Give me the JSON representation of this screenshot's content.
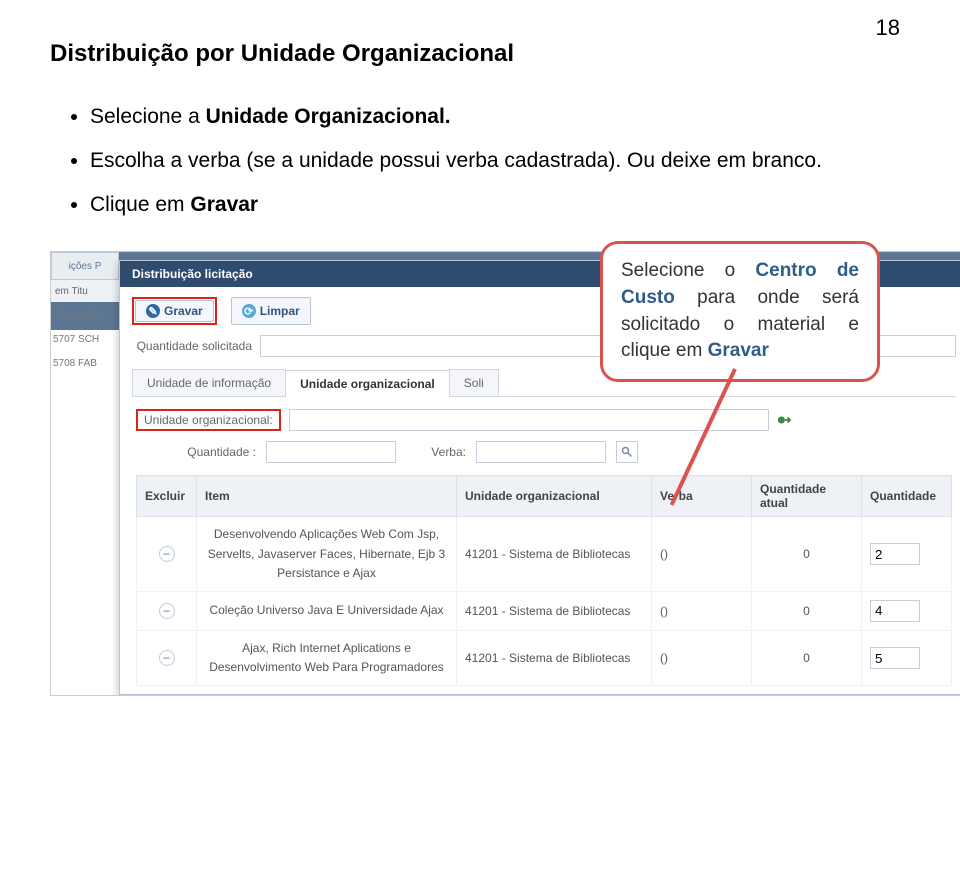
{
  "page_number": "18",
  "title": "Distribuição por Unidade Organizacional",
  "instructions": {
    "i1a": "Selecione a ",
    "i1b": "Unidade Organizacional.",
    "i2": "Escolha a verba (se a unidade possui verba cadastrada). Ou deixe em branco.",
    "i3a": "Clique em ",
    "i3b": "Gravar"
  },
  "callout": {
    "t1": "Selecione o ",
    "t2": "Centro de Custo",
    "t3": " para onde será solicitado o material e clique em ",
    "t4": "Gravar"
  },
  "bg": {
    "tab": "ições    P",
    "header": "em    Titu",
    "rows": [
      "5706   NEU",
      "5707   SCH",
      "5708   FAB"
    ]
  },
  "modal": {
    "title": "Distribuição licitação",
    "buttons": {
      "gravar": "Gravar",
      "limpar": "Limpar"
    },
    "qty_label": "Quantidade solicitada",
    "tabs": {
      "t1": "Unidade de informação",
      "t2": "Unidade organizacional",
      "t3": "Soli"
    },
    "uo_label": "Unidade organizacional:",
    "qv": {
      "qtd": "Quantidade :",
      "verba": "Verba:"
    },
    "grid": {
      "headers": {
        "excluir": "Excluir",
        "item": "Item",
        "uo": "Unidade organizacional",
        "verba": "Verba",
        "qatual": "Quantidade atual",
        "qtd": "Quantidade"
      },
      "rows": [
        {
          "item": "Desenvolvendo Aplicações Web Com Jsp, Servelts, Javaserver Faces, Hibernate, Ejb 3 Persistance e Ajax",
          "uo": "41201 - Sistema de Bibliotecas",
          "verba": "()",
          "qatual": "0",
          "qtd": "2"
        },
        {
          "item": "Coleção Universo Java E Universidade Ajax",
          "uo": "41201 - Sistema de Bibliotecas",
          "verba": "()",
          "qatual": "0",
          "qtd": "4"
        },
        {
          "item": "Ajax, Rich Internet Aplications e Desenvolvimento Web Para Programadores",
          "uo": "41201 - Sistema de Bibliotecas",
          "verba": "()",
          "qatual": "0",
          "qtd": "5"
        }
      ]
    }
  }
}
